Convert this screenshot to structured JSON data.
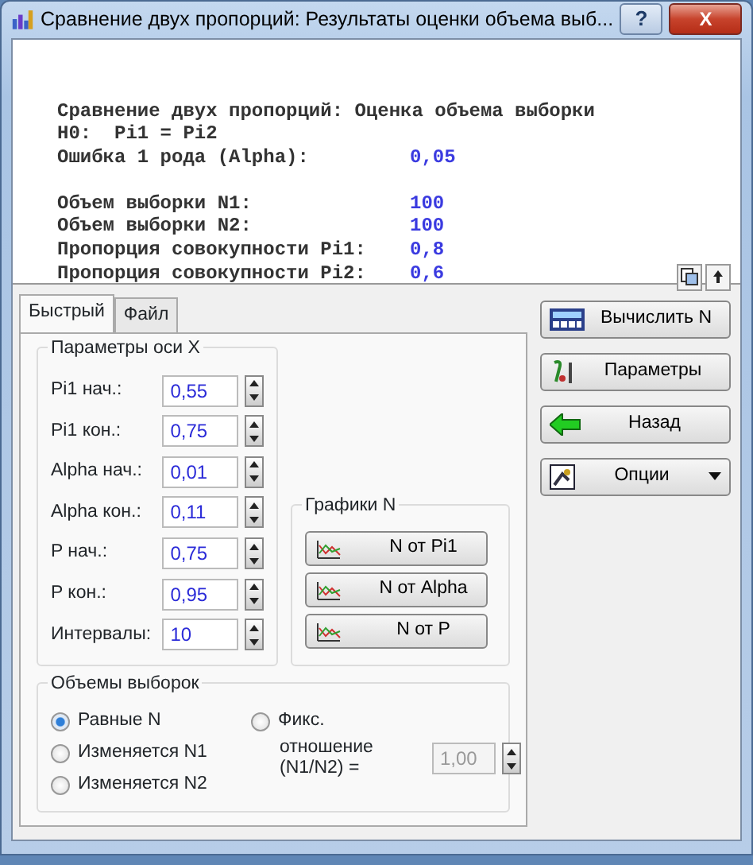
{
  "window": {
    "title": "Сравнение двух пропорций: Результаты оценки объема выб...",
    "help": "?",
    "close": "X"
  },
  "report": {
    "heading": "Сравнение двух пропорций: Оценка объема выборки",
    "hypothesis": "H0:  Pi1 = Pi2",
    "groups": [
      [
        {
          "label": "Ошибка 1 рода (Alpha):",
          "value": "0,05"
        }
      ],
      [
        {
          "label": "Объем выборки N1:",
          "value": "100"
        },
        {
          "label": "Объем выборки N2:",
          "value": "100"
        },
        {
          "label": "Пропорция совокупности Pi1:",
          "value": "0,8"
        },
        {
          "label": "Пропорция совокупности Pi2:",
          "value": "0,6"
        }
      ]
    ]
  },
  "tabs": [
    {
      "label": "Быстрый",
      "selected": true
    },
    {
      "label": "Файл",
      "selected": false
    }
  ],
  "axis_params": {
    "title": "Параметры оси X",
    "fields": [
      {
        "label": "Pi1 нач.:",
        "value": "0,55"
      },
      {
        "label": "Pi1 кон.:",
        "value": "0,75"
      },
      {
        "label": "Alpha нач.:",
        "value": "0,01"
      },
      {
        "label": "Alpha кон.:",
        "value": "0,11"
      },
      {
        "label": "P нач.:",
        "value": "0,75"
      },
      {
        "label": "P кон.:",
        "value": "0,95"
      },
      {
        "label": "Интервалы:",
        "value": "10"
      }
    ]
  },
  "charts": {
    "title": "Графики N",
    "buttons": [
      "N от Pi1",
      "N от Alpha",
      "N от P"
    ]
  },
  "sample_sizes": {
    "title": "Объемы выборок",
    "options": [
      {
        "label": "Равные N",
        "selected": true
      },
      {
        "label": "Изменяется N1",
        "selected": false
      },
      {
        "label": "Изменяется N2",
        "selected": false
      }
    ],
    "fixed": {
      "label": "Фикс.",
      "selected": false,
      "ratio_label": "отношение (N1/N2) =",
      "ratio_value": "1,00",
      "disabled": true
    }
  },
  "actions": [
    {
      "label": "Вычислить N",
      "kind": "compute"
    },
    {
      "label": "Параметры",
      "kind": "params"
    },
    {
      "label": "Назад",
      "kind": "back"
    },
    {
      "label": "Опции",
      "kind": "options"
    }
  ]
}
